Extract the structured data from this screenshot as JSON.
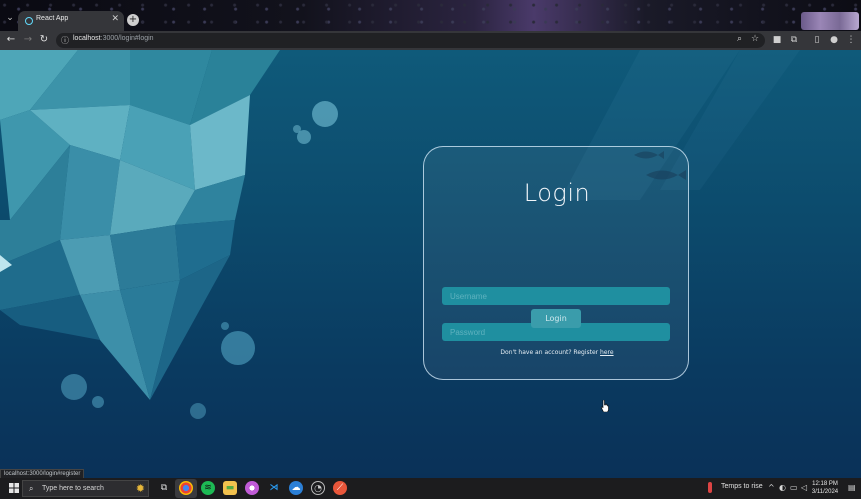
{
  "browser": {
    "tab_title": "React App",
    "tab_close": "✕",
    "new_tab": "+",
    "url_host": "localhost",
    "url_path": ":3000/login#login",
    "status_link": "localhost:3000/login#register"
  },
  "login": {
    "title": "Login",
    "username_placeholder": "Username",
    "password_placeholder": "Password",
    "button_label": "Login",
    "register_prompt": "Don't have an account? Register ",
    "register_link": "here"
  },
  "taskbar": {
    "search_placeholder": "Type here to search",
    "weather": "Temps to rise",
    "time": "12:18 PM",
    "date": "3/11/2024"
  },
  "colors": {
    "ocean_top": "#0f5a7a",
    "ocean_bottom": "#0a3158",
    "input_fill": "#1f8fa0",
    "button_fill": "#3a9cab"
  }
}
